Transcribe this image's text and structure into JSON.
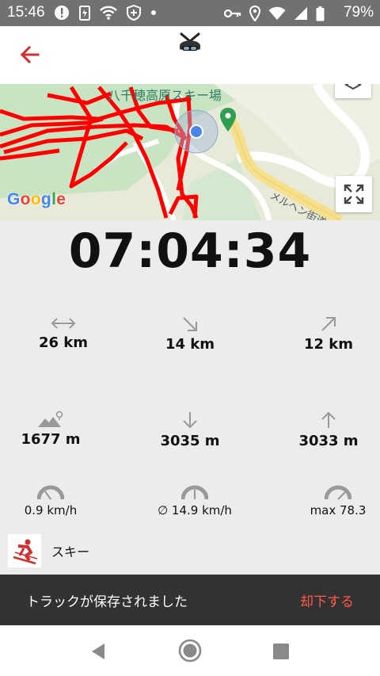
{
  "status_bar": {
    "time": "15:46",
    "battery": "79%",
    "left_icons": [
      "alert-icon",
      "battery-saver-icon",
      "wifi-icon",
      "vpn-shield-icon",
      "dot-icon"
    ],
    "right_icons": [
      "key-icon",
      "location-icon",
      "wifi-icon",
      "signal-icon",
      "battery-icon"
    ]
  },
  "header": {
    "back_icon": "arrow-left-icon",
    "logo_icon": "ski-helmet-logo-icon",
    "accent": "#d32f2f"
  },
  "map": {
    "place_label": "八千穂高原スキー場",
    "road_label": "メルヘン街道",
    "attribution": [
      "G",
      "o",
      "o",
      "g",
      "l",
      "e"
    ],
    "track_color": "#ff0000"
  },
  "timer": "07:04:34",
  "stats": {
    "distance": "26 km",
    "downhill_distance": "14 km",
    "uphill_distance": "12 km",
    "altitude": "1677 m",
    "descent": "3035 m",
    "ascent": "3033 m",
    "current_speed": "0.9 km/h",
    "avg_speed": "∅ 14.9 km/h",
    "max_speed": "max 78.3"
  },
  "activity": {
    "label": "スキー",
    "icon": "skier-icon"
  },
  "snackbar": {
    "message": "トラックが保存されました",
    "action": "却下する"
  },
  "navbar": {
    "icons": [
      "nav-back-icon",
      "nav-home-icon",
      "nav-recents-icon"
    ]
  }
}
